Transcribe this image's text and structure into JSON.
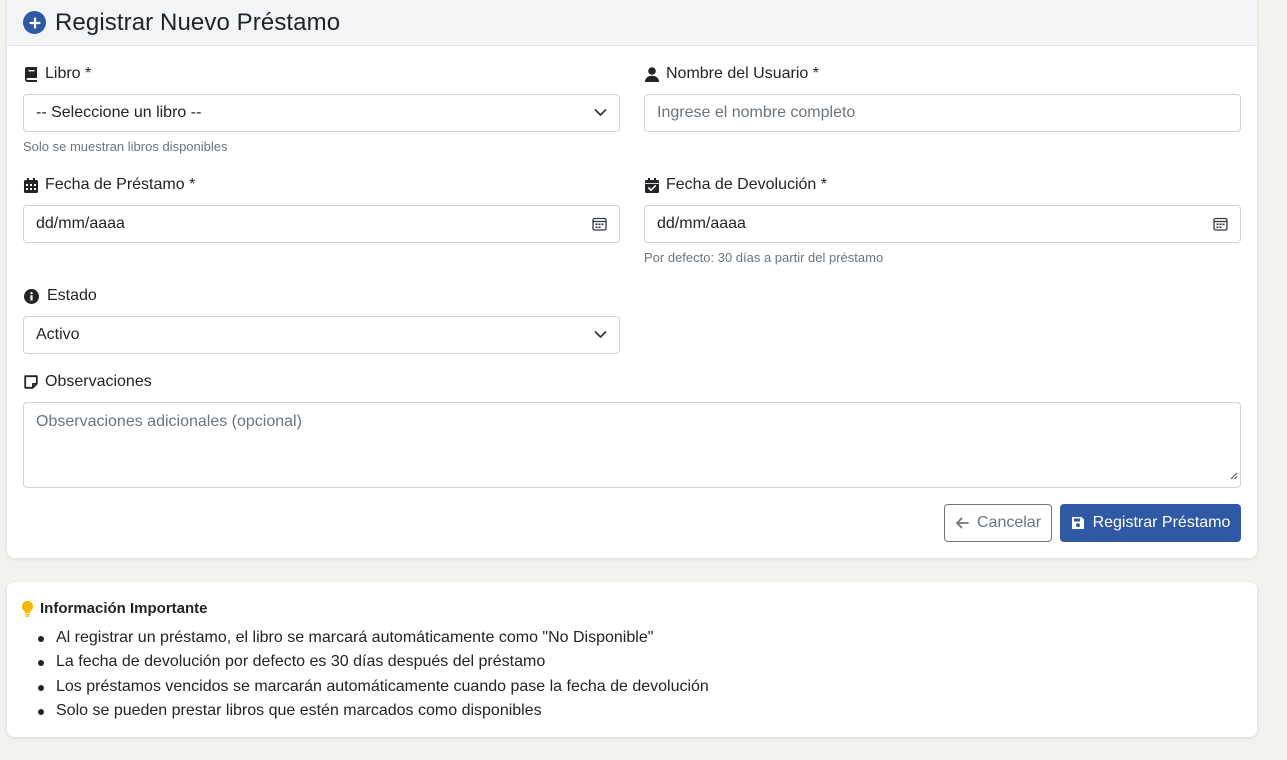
{
  "header": {
    "title": "Registrar Nuevo Préstamo",
    "icon": "plus-circle-icon",
    "accent": "#2f58a5"
  },
  "form": {
    "libro": {
      "label": "Libro *",
      "icon": "book-icon",
      "value": "-- Seleccione un libro --",
      "hint": "Solo se muestran libros disponibles"
    },
    "usuario": {
      "label": "Nombre del Usuario *",
      "icon": "user-icon",
      "placeholder": "Ingrese el nombre completo"
    },
    "fecha_prestamo": {
      "label": "Fecha de Préstamo *",
      "icon": "calendar-icon",
      "value": "dd/mm/aaaa"
    },
    "fecha_devolucion": {
      "label": "Fecha de Devolución *",
      "icon": "calendar-check-icon",
      "value": "dd/mm/aaaa",
      "hint": "Por defecto: 30 días a partir del préstamo"
    },
    "estado": {
      "label": "Estado",
      "icon": "info-circle-icon",
      "value": "Activo"
    },
    "observaciones": {
      "label": "Observaciones",
      "icon": "sticky-note-icon",
      "placeholder": "Observaciones adicionales (opcional)"
    },
    "cancel_label": "Cancelar",
    "submit_label": "Registrar Préstamo"
  },
  "info": {
    "title": "Información Importante",
    "icon": "lightbulb-icon",
    "icon_color": "#f5b800",
    "items": [
      "Al registrar un préstamo, el libro se marcará automáticamente como \"No Disponible\"",
      "La fecha de devolución por defecto es 30 días después del préstamo",
      "Los préstamos vencidos se marcarán automáticamente cuando pase la fecha de devolución",
      "Solo se pueden prestar libros que estén marcados como disponibles"
    ]
  }
}
